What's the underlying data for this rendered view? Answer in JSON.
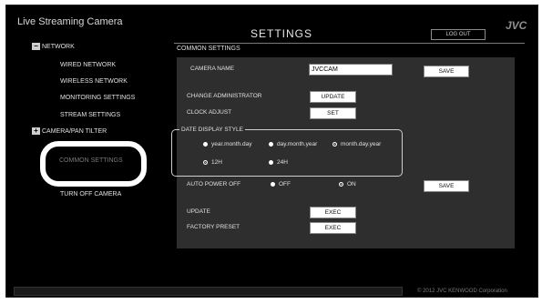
{
  "header": {
    "app_title": "Live Streaming Camera",
    "page_title": "SETTINGS",
    "logout_label": "LOG OUT",
    "logo": "JVC"
  },
  "sidebar": {
    "network_section": {
      "icon": "minus-box-icon",
      "glyph": "−",
      "label": "NETWORK"
    },
    "network_items": [
      "WIRED NETWORK",
      "WIRELESS NETWORK",
      "MONITORING SETTINGS",
      "STREAM SETTINGS"
    ],
    "camera_section": {
      "icon": "plus-box-icon",
      "glyph": "+",
      "label": "CAMERA/PAN TILTER"
    },
    "common_settings": "COMMON SETTINGS",
    "turn_off": "TURN OFF CAMERA"
  },
  "main": {
    "section_title": "COMMON SETTINGS",
    "camera_name_label": "CAMERA NAME",
    "camera_name_value": "JVCCAM",
    "save_label": "SAVE",
    "change_admin_label": "CHANGE ADMINISTRATOR",
    "update_label": "UPDATE",
    "clock_adjust_label": "CLOCK ADJUST",
    "set_label": "SET",
    "date_style": {
      "legend": "DATE DISPLAY STYLE",
      "date_formats": [
        "year.month.day",
        "day.month.year",
        "month.day.year"
      ],
      "selected_date_format": "month.day.year",
      "time_formats": [
        "12H",
        "24H"
      ],
      "selected_time_format": "12H"
    },
    "auto_power_off_label": "AUTO POWER OFF",
    "power_options": [
      "OFF",
      "ON"
    ],
    "selected_power_option": "ON",
    "save2_label": "SAVE",
    "update_row_label": "UPDATE",
    "factory_preset_label": "FACTORY PRESET",
    "exec_label": "EXEC"
  },
  "footer": {
    "copyright": "© 2012 JVC KENWOOD Corporation"
  }
}
